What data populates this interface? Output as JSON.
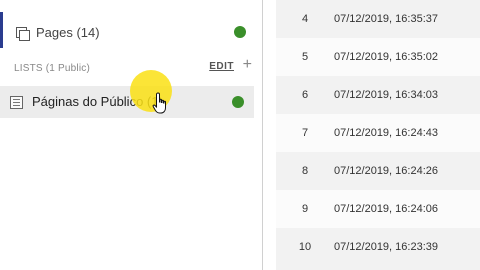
{
  "sidebar": {
    "pages_label": "Pages (14)",
    "lists_label": "LISTS (1 Public)",
    "edit_label": "EDIT",
    "add_label": "+",
    "list_item_label": "Páginas do Público (1)"
  },
  "colors": {
    "status_green": "#3a8f2a",
    "accent": "#2a3c8f",
    "highlight": "#fae114"
  },
  "table": {
    "rows": [
      {
        "num": "4",
        "ts": "07/12/2019, 16:35:37"
      },
      {
        "num": "5",
        "ts": "07/12/2019, 16:35:02"
      },
      {
        "num": "6",
        "ts": "07/12/2019, 16:34:03"
      },
      {
        "num": "7",
        "ts": "07/12/2019, 16:24:43"
      },
      {
        "num": "8",
        "ts": "07/12/2019, 16:24:26"
      },
      {
        "num": "9",
        "ts": "07/12/2019, 16:24:06"
      },
      {
        "num": "10",
        "ts": "07/12/2019, 16:23:39"
      }
    ]
  }
}
